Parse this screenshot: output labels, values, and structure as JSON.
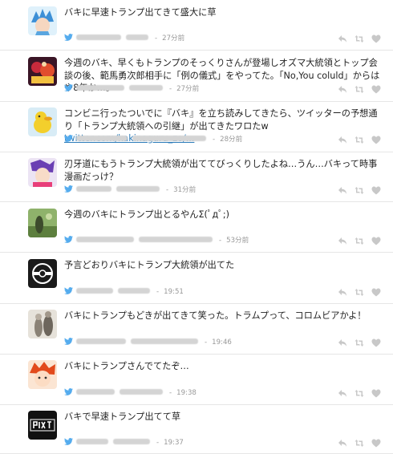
{
  "tweets": [
    {
      "text": "バキに早速トランプ出てきて盛大に草",
      "time": "27分前"
    },
    {
      "text": "今週のバキ、早くもトランプのそっくりさんが登場しオズマ大統領とトップ会談の後、範馬勇次郎相手に「例の儀式」をやってた。「No,You coluld」からはや8年か…。",
      "time": "27分前"
    },
    {
      "text_before": "コンビニ行ったついでに『バキ』を立ち読みしてきたら、ツイッターの予想通り「トランプ大統領への引継」が出てきたワロたw ",
      "link": "twitter.com/kakinaguru_zo/...",
      "time": "28分前"
    },
    {
      "text": "刃牙道にもうトランプ大統領が出ててびっくりしたよね…うん…バキって時事漫画だっけ？",
      "time": "31分前"
    },
    {
      "text": "今週のバキにトランプ出とるやんΣ(ﾟдﾟ;)",
      "time": "53分前"
    },
    {
      "text": "予言どおりバキにトランプ大統領が出てた",
      "time": "19:51"
    },
    {
      "text": "バキにトランプもどきが出てきて笑った。トラムプって、コロムビアかよ！",
      "time": "19:46"
    },
    {
      "text": "バキにトランプさんでてたぞ…",
      "time": "19:38"
    },
    {
      "text": "バキで早速トランプ出てて草",
      "time": "19:37"
    }
  ],
  "colors": {
    "link": "#2b7bb9",
    "twitter_blue": "#55acee",
    "meta_gray": "#999999",
    "icon_gray": "#c8c8c8"
  },
  "icons": {
    "source": "twitter-bird-icon",
    "reply": "reply-icon",
    "retweet": "retweet-icon",
    "like": "heart-icon"
  }
}
